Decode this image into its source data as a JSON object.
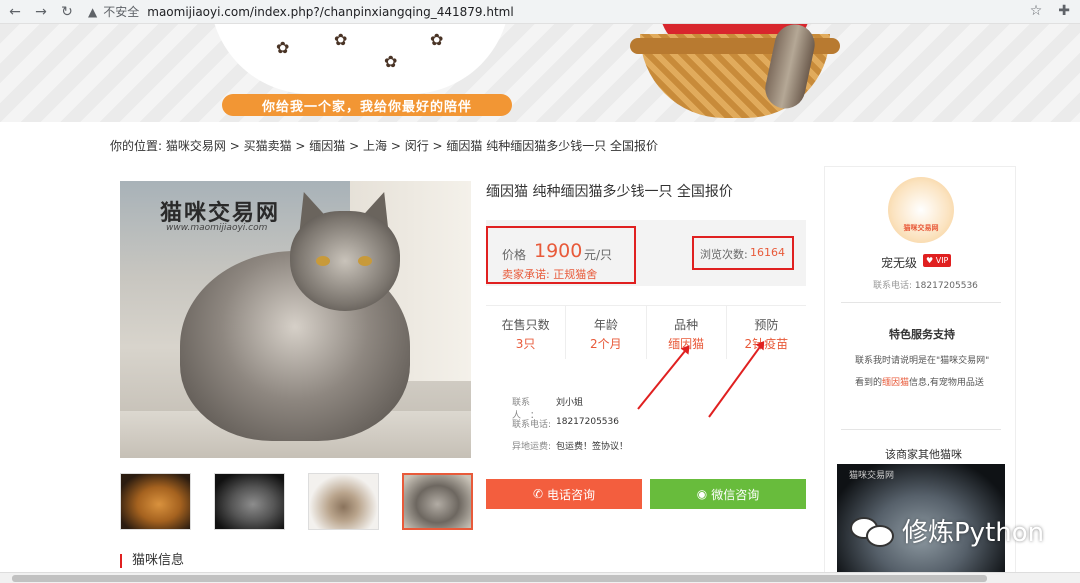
{
  "browser": {
    "security_label": "不安全",
    "url": "maomijiaoyi.com/index.php?/chanpinxiangqing_441879.html"
  },
  "banner": {
    "slogan": "你给我一个家，我给你最好的陪伴"
  },
  "breadcrumb": {
    "prefix": "你的位置:",
    "items": [
      "猫咪交易网",
      "买猫卖猫",
      "缅因猫",
      "上海",
      "闵行",
      "缅因猫 纯种缅因猫多少钱一只 全国报价"
    ],
    "separator": " > "
  },
  "photo": {
    "watermark_cn": "猫咪交易网",
    "watermark_url": "www.maomijiaoyi.com"
  },
  "product": {
    "title": "缅因猫 纯种缅因猫多少钱一只 全国报价",
    "price_label": "价格",
    "price_value": "1900",
    "price_unit": "元/只",
    "promise": "卖家承诺: 正规猫舍",
    "views_label": "浏览次数:",
    "views_value": "16164",
    "stats": [
      {
        "label": "在售只数",
        "value": "3只"
      },
      {
        "label": "年龄",
        "value": "2个月"
      },
      {
        "label": "品种",
        "value": "缅因猫"
      },
      {
        "label": "预防",
        "value": "2针疫苗"
      }
    ],
    "contact": {
      "person_label": "联系人　：",
      "person_value": "刘小姐",
      "phone_label": "联系电话:",
      "phone_value": "18217205536",
      "ship_label": "异地运费:",
      "ship_value": "包运费！签协议！"
    },
    "call_button": "电话咨询",
    "wechat_button": "微信咨询"
  },
  "section": {
    "cat_info": "猫咪信息"
  },
  "sidebar": {
    "logo_text": "猫咪交易网",
    "seller_name": "宠无级",
    "vip": "VIP",
    "phone_label": "联系电话:",
    "phone_value": "18217205536",
    "service_title": "特色服务支持",
    "service_line1": "联系我时请说明是在\"猫咪交易网\"",
    "service_line2_pre": "看到的",
    "service_line2_hl": "缅因猫",
    "service_line2_post": "信息,有宠物用品送",
    "other_title": "该商家其他猫咪",
    "other_watermark": "猫咪交易网"
  },
  "watermark": {
    "text": "修炼Python"
  },
  "colors": {
    "accent": "#e85a3a",
    "highlight_border": "#e02020",
    "call_button": "#f35e3e",
    "wechat_button": "#68bc3c",
    "slogan_bg": "#f29634"
  }
}
